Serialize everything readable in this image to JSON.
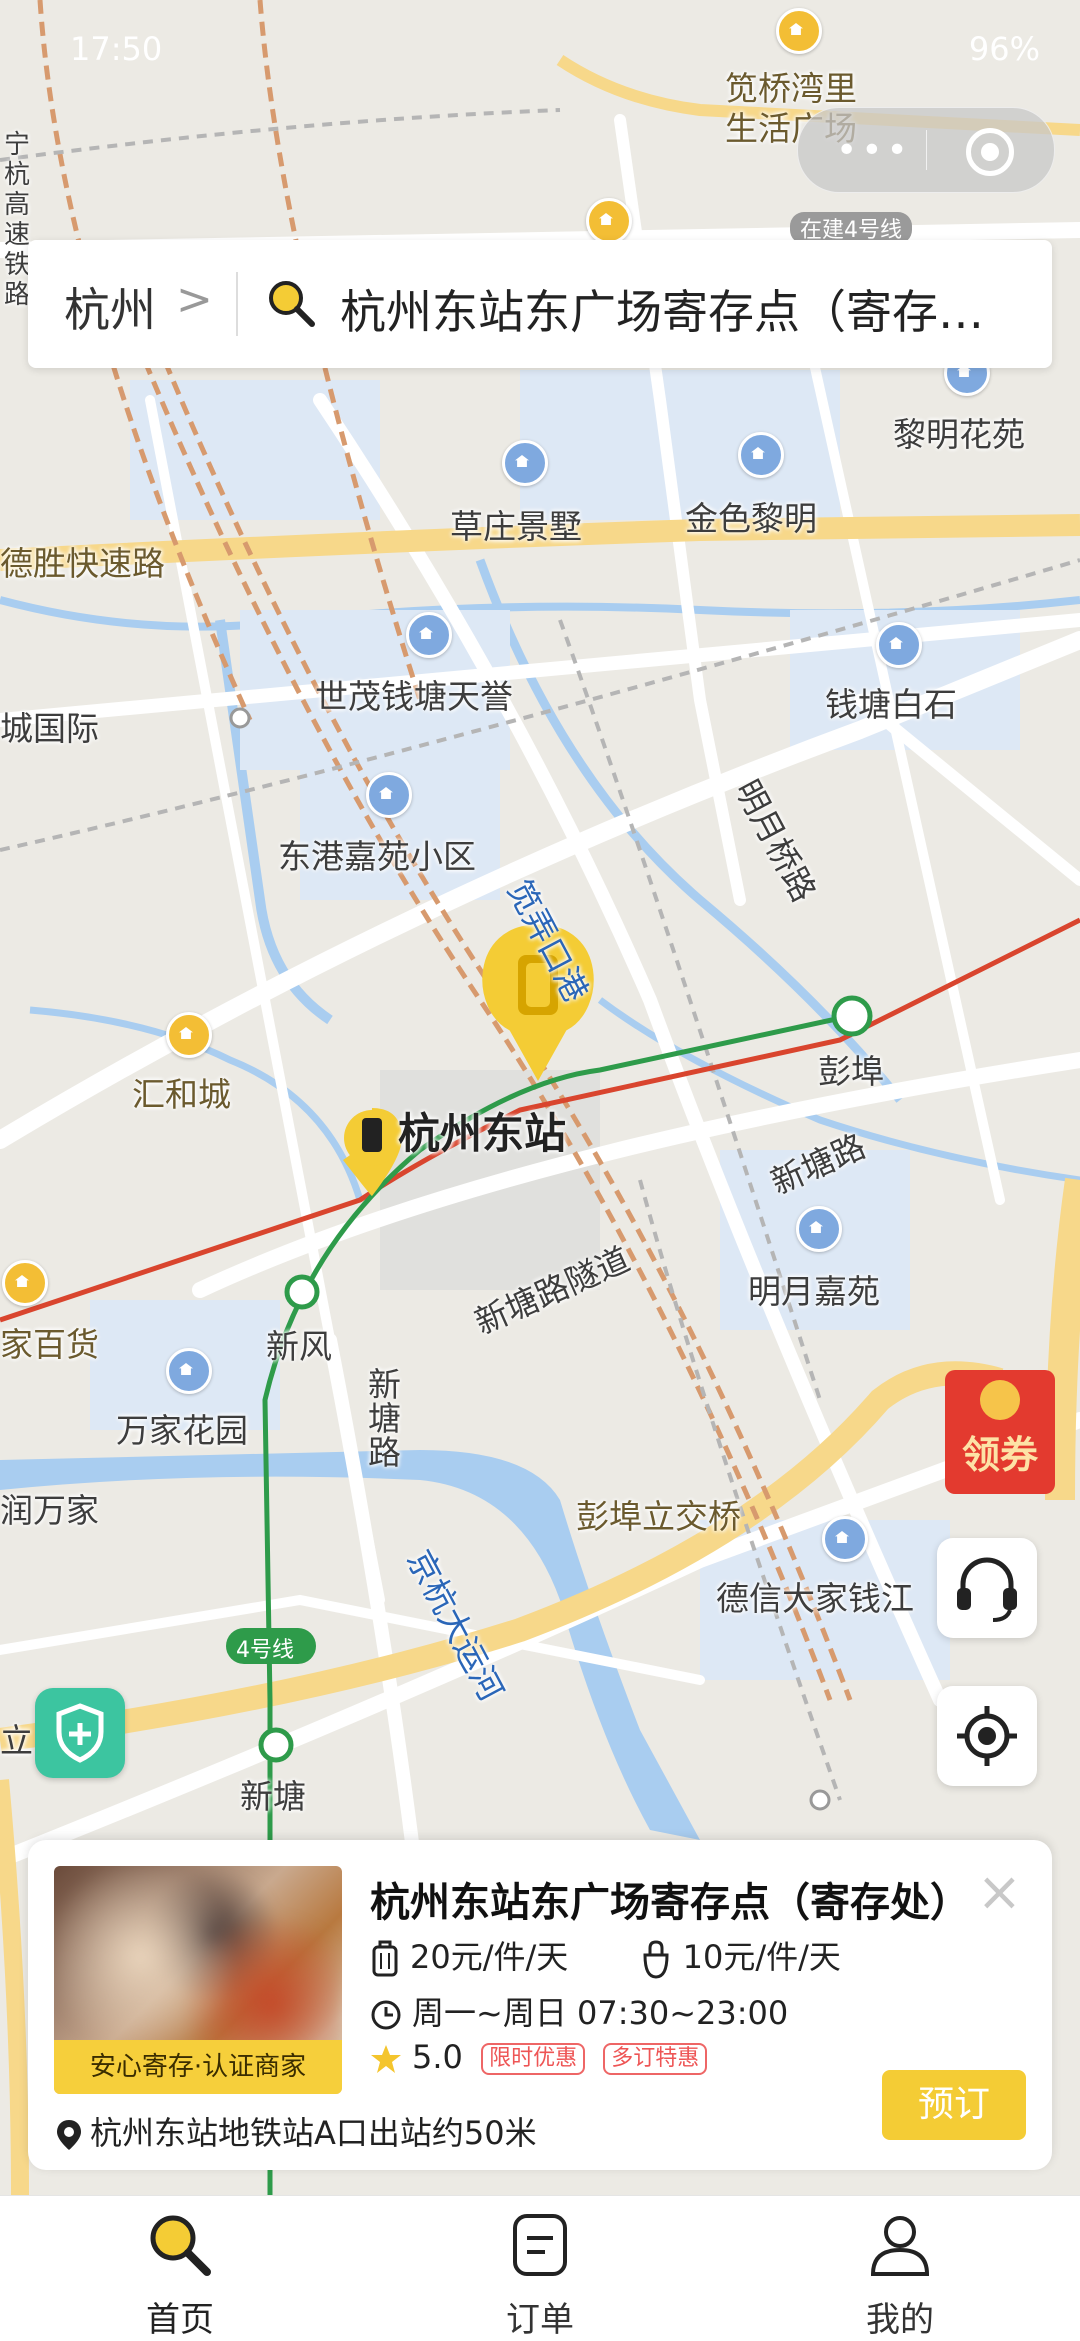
{
  "status_bar": {
    "time": "17:50",
    "battery": "96%"
  },
  "search": {
    "city": "杭州",
    "chevron": ">",
    "query": "杭州东站东广场寄存点（寄存…"
  },
  "map": {
    "labels": {
      "jq_wanli": "笕桥湾里",
      "life_plaza": "生活广场",
      "line4_service": "在建4号线",
      "ninghang": "宁杭高速铁路",
      "liming": "黎明花苑",
      "caozhuang": "草庄景墅",
      "jinse": "金色黎明",
      "desheng": "德胜快速路",
      "shimao": "世茂钱塘天誉",
      "qiantang_baishi": "钱塘白石",
      "cheng_guoji": "城国际",
      "donggang": "东港嘉苑小区",
      "jiannong": "笕弄口港",
      "mingyue_bridge": "明月桥路",
      "huihe": "汇和城",
      "hz_east": "杭州东站",
      "pengbu": "彭埠",
      "xintang_road": "新塘路",
      "xintang_tunnel": "新塘路隧道",
      "mingyue_jiayuan": "明月嘉苑",
      "jiajia": "家百货",
      "xinfeng": "新风",
      "wanjia_garden": "万家花园",
      "xintang_road2": "新塘路",
      "runwanjia": "润万家",
      "pengbu_bridge": "彭埠立交桥",
      "dexin": "德信大家钱江",
      "jinghang": "京杭大运河",
      "line4": "4号线",
      "xintang": "新塘",
      "li": "立"
    }
  },
  "coupon": {
    "label": "领券"
  },
  "card": {
    "badge": "安心寄存·认证商家",
    "title": "杭州东站东广场寄存点（寄存处）",
    "price_large": "20元/件/天",
    "price_small": "10元/件/天",
    "hours": "周一~周日 07:30~23:00",
    "rating": "5.0",
    "tag1": "限时优惠",
    "tag2": "多订特惠",
    "address": "杭州东站地铁站A口出站约50米",
    "book_label": "预订",
    "close": "×"
  },
  "tabs": [
    {
      "label": "首页",
      "icon": "search-icon"
    },
    {
      "label": "订单",
      "icon": "order-icon"
    },
    {
      "label": "我的",
      "icon": "user-icon"
    }
  ],
  "colors": {
    "accent": "#f4cc35",
    "metro_line4": "#2e9b4a",
    "rail_red": "#d9452e",
    "water": "#a7cbef"
  }
}
